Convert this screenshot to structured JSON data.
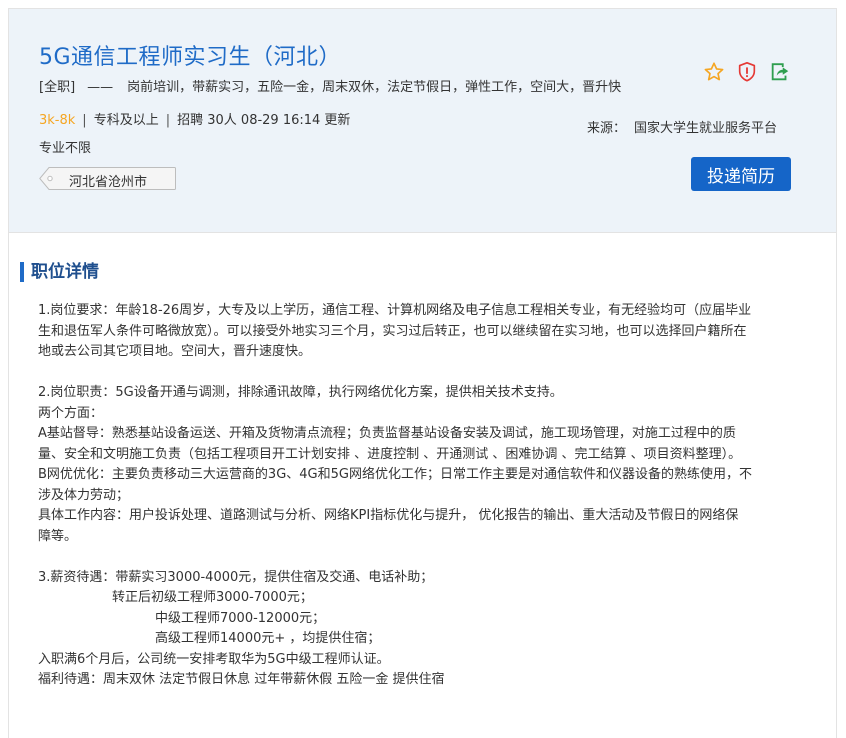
{
  "job": {
    "title": "5G通信工程师实习生（河北）",
    "type": "[全职]",
    "dash": "——",
    "benefits": "岗前培训，带薪实习，五险一金，周末双休，法定节假日，弹性工作，空间大，晋升快",
    "salary": "3k-8k",
    "separator": "|",
    "education": "专科及以上",
    "headcount": "招聘 30人",
    "updated": "08-29 16:14 更新",
    "major": "专业不限",
    "location": "河北省沧州市"
  },
  "actions": {
    "favorite_icon": "star-icon",
    "report_icon": "shield-alert-icon",
    "share_icon": "share-icon",
    "apply_label": "投递简历"
  },
  "source": {
    "label": "来源：",
    "name": "国家大学生就业服务平台"
  },
  "details": {
    "section_title": "职位详情",
    "lines": [
      "1.岗位要求：年龄18-26周岁，大专及以上学历，通信工程、计算机网络及电子信息工程相关专业，有无经验均可（应届毕业",
      "生和退伍军人条件可略微放宽）。可以接受外地实习三个月，实习过后转正，也可以继续留在实习地，也可以选择回户籍所在",
      "地或去公司其它项目地。空间大，晋升速度快。",
      "",
      "2.岗位职责：5G设备开通与调测，排除通讯故障，执行网络优化方案，提供相关技术支持。",
      "两个方面：",
      "A基站督导：熟悉基站设备运送、开箱及货物清点流程；负责监督基站设备安装及调试，施工现场管理，对施工过程中的质",
      "量、安全和文明施工负责（包括工程项目开工计划安排 、进度控制 、开通测试 、困难协调 、完工结算 、项目资料整理）。",
      "B网优优化：主要负责移动三大运营商的3G、4G和5G网络优化工作；日常工作主要是对通信软件和仪器设备的熟练使用，不",
      "涉及体力劳动；",
      "具体工作内容：用户投诉处理、道路测试与分析、网络KPI指标优化与提升， 优化报告的输出、重大活动及节假日的网络保",
      "障等。",
      "",
      "3.薪资待遇：带薪实习3000-4000元，提供住宿及交通、电话补助；",
      "转正后初级工程师3000-7000元；",
      "中级工程师7000-12000元；",
      "高级工程师14000元+ ，均提供住宿；",
      "入职满6个月后，公司统一安排考取华为5G中级工程师认证。",
      "福利待遇：周末双休 法定节假日休息 过年带薪休假 五险一金 提供住宿"
    ]
  },
  "colors": {
    "title_blue": "#1f6bc7",
    "salary_orange": "#f5a623",
    "button_blue": "#1565c8",
    "header_bg": "#edf3f9",
    "report_red": "#e53935",
    "share_green": "#2e9e4f"
  }
}
